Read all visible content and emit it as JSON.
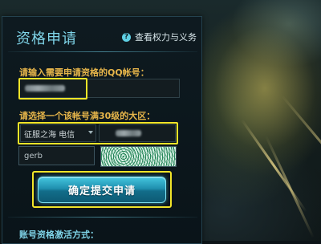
{
  "form": {
    "title": "资格申请",
    "rights_link": "查看权力与义务",
    "help_icon_glyph": "?",
    "qq_label": "请输入需要申请资格的QQ帐号：",
    "region_label": "请选择一个该帐号满30级的大区：",
    "region_selected": "征服之海 电信",
    "captcha_value": "gerb",
    "submit_label": "确定提交申请",
    "activation_label": "账号资格激活方式："
  },
  "colors": {
    "title": "#7fd4e8",
    "label": "#e6b54a",
    "highlight": "#f2e528",
    "button": "#1f8fae"
  }
}
